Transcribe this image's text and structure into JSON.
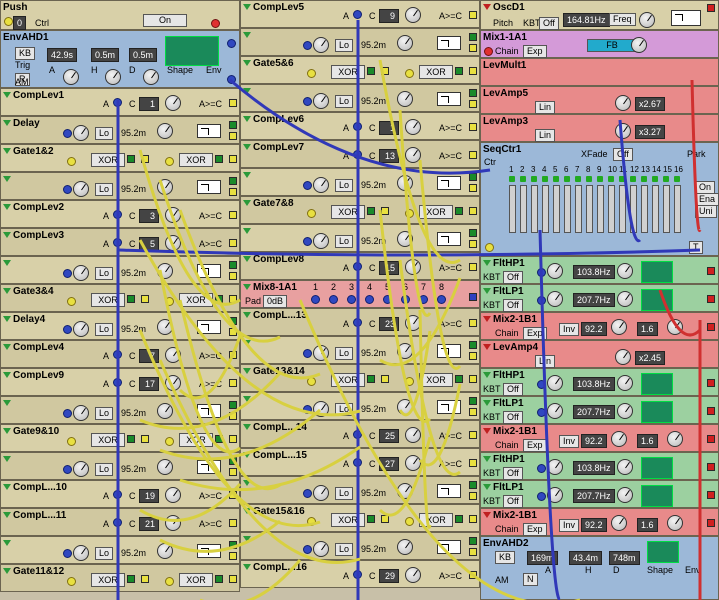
{
  "col1": [
    {
      "title": "Push",
      "ctrl_value": "0",
      "ctrl_label": "Ctrl",
      "on_label": "On",
      "color": "tan"
    },
    {
      "title": "EnvAHD1",
      "kb_label": "KB",
      "trig_label": "Trig",
      "r_label": "R",
      "am_label": "AM",
      "a_value": "42.9s",
      "h_value": "0.5m",
      "d_value": "0.5m",
      "a_label": "A",
      "h_label": "H",
      "d_label": "D",
      "shape_label": "Shape",
      "env_label": "Env",
      "color": "blue"
    },
    {
      "title": "CompLev1",
      "a_label": "A",
      "c_label": "C",
      "c_value": "1",
      "cmp_label": "A>=C",
      "color": "tan"
    },
    {
      "title": "Delay",
      "lo_label": "Lo",
      "value": "95.2m",
      "color": "tan"
    },
    {
      "title": "Gate1&2",
      "xor_label": "XOR",
      "color": "tan"
    },
    {
      "title": "",
      "lo_label": "Lo",
      "value": "95.2m",
      "color": "tan"
    },
    {
      "title": "CompLev2",
      "a_label": "A",
      "c_label": "C",
      "c_value": "3",
      "cmp_label": "A>=C",
      "color": "tan"
    },
    {
      "title": "CompLev3",
      "a_label": "A",
      "c_label": "C",
      "c_value": "5",
      "cmp_label": "A>=C",
      "color": "tan"
    },
    {
      "title": "",
      "lo_label": "Lo",
      "value": "95.2m",
      "color": "tan"
    },
    {
      "title": "Gate3&4",
      "xor_label": "XOR",
      "color": "tan"
    },
    {
      "title": "Delay4",
      "lo_label": "Lo",
      "value": "95.2m",
      "color": "tan"
    },
    {
      "title": "CompLev4",
      "a_label": "A",
      "c_label": "C",
      "c_value": "7",
      "cmp_label": "A>=C",
      "color": "tan"
    },
    {
      "title": "CompLev9",
      "a_label": "A",
      "c_label": "C",
      "c_value": "17",
      "cmp_label": "A>=C",
      "color": "tan"
    },
    {
      "title": "",
      "lo_label": "Lo",
      "value": "95.2m",
      "color": "tan"
    },
    {
      "title": "Gate9&10",
      "xor_label": "XOR",
      "color": "tan"
    },
    {
      "title": "",
      "lo_label": "Lo",
      "value": "95.2m",
      "color": "tan"
    },
    {
      "title": "CompL...10",
      "a_label": "A",
      "c_label": "C",
      "c_value": "19",
      "cmp_label": "A>=C",
      "color": "tan"
    },
    {
      "title": "CompL...11",
      "a_label": "A",
      "c_label": "C",
      "c_value": "21",
      "cmp_label": "A>=C",
      "color": "tan"
    },
    {
      "title": "",
      "lo_label": "Lo",
      "value": "95.2m",
      "color": "tan"
    },
    {
      "title": "Gate11&12",
      "xor_label": "XOR",
      "color": "tan"
    }
  ],
  "col2": [
    {
      "title": "CompLev5",
      "a_label": "A",
      "c_label": "C",
      "c_value": "9",
      "cmp_label": "A>=C"
    },
    {
      "title": "",
      "lo_label": "Lo",
      "value": "95.2m"
    },
    {
      "title": "Gate5&6",
      "xor_label": "XOR"
    },
    {
      "title": "",
      "lo_label": "Lo",
      "value": "95.2m"
    },
    {
      "title": "CompLev6",
      "a_label": "A",
      "c_label": "C",
      "c_value": "1",
      "cmp_label": "A>=C"
    },
    {
      "title": "CompLev7",
      "a_label": "A",
      "c_label": "C",
      "c_value": "13",
      "cmp_label": "A>=C"
    },
    {
      "title": "",
      "lo_label": "Lo",
      "value": "95.2m"
    },
    {
      "title": "Gate7&8",
      "xor_label": "XOR"
    },
    {
      "title": "",
      "lo_label": "Lo",
      "value": "95.2m"
    },
    {
      "title": "CompLev8",
      "a_label": "A",
      "c_label": "C",
      "c_value": "15",
      "cmp_label": "A>=C"
    },
    {
      "title": "Mix8-1A1",
      "pad_label": "Pad",
      "pad_value": "0dB",
      "inputs": [
        "1",
        "2",
        "3",
        "4",
        "5",
        "6",
        "7",
        "8"
      ]
    },
    {
      "title": "CompL...13",
      "a_label": "A",
      "c_label": "C",
      "c_value": "23",
      "cmp_label": "A>=C"
    },
    {
      "title": "",
      "lo_label": "Lo",
      "value": "95.2m"
    },
    {
      "title": "Gate13&14",
      "xor_label": "XOR"
    },
    {
      "title": "",
      "lo_label": "Lo",
      "value": "95.2m"
    },
    {
      "title": "CompL...14",
      "a_label": "A",
      "c_label": "C",
      "c_value": "25",
      "cmp_label": "A>=C"
    },
    {
      "title": "CompL...15",
      "a_label": "A",
      "c_label": "C",
      "c_value": "27",
      "cmp_label": "A>=C"
    },
    {
      "title": "",
      "lo_label": "Lo",
      "value": "95.2m"
    },
    {
      "title": "Gate15&16",
      "xor_label": "XOR"
    },
    {
      "title": "",
      "lo_label": "Lo",
      "value": "95.2m"
    },
    {
      "title": "CompL...16",
      "a_label": "A",
      "c_label": "C",
      "c_value": "29",
      "cmp_label": "A>=C"
    }
  ],
  "col3": {
    "osc": {
      "title": "OscD1",
      "pitch_label": "Pitch",
      "kbt_label": "KBT",
      "kbt_value": "Off",
      "freq_value": "164.81Hz",
      "freq_label": "Freq"
    },
    "mix1": {
      "title": "Mix1-1A1",
      "chain_label": "Chain",
      "exp_label": "Exp",
      "fb_label": "FB"
    },
    "levmult": {
      "title": "LevMult1"
    },
    "levamp5": {
      "title": "LevAmp5",
      "lin_label": "Lin",
      "value": "x2.67"
    },
    "levamp3": {
      "title": "LevAmp3",
      "lin_label": "Lin",
      "value": "x3.27"
    },
    "seq": {
      "title": "SeqCtr1",
      "xfade_label": "XFade",
      "xfade_value": "Off",
      "ctr_label": "Ctr",
      "park_label": "Park",
      "steps": [
        "1",
        "2",
        "3",
        "4",
        "5",
        "6",
        "7",
        "8",
        "9",
        "10",
        "11",
        "12",
        "13",
        "14",
        "15",
        "16"
      ],
      "side_labels": [
        "On",
        "Ena",
        "Uni"
      ],
      "t_label": "T"
    },
    "filters": [
      {
        "title": "FltHP1",
        "kbt_label": "KBT",
        "kbt_value": "Off",
        "value": "103.8Hz",
        "kind": "hp"
      },
      {
        "title": "FltLP1",
        "kbt_label": "KBT",
        "kbt_value": "Off",
        "value": "207.7Hz",
        "kind": "lp"
      }
    ],
    "mix2a": {
      "title": "Mix2-1B1",
      "chain_label": "Chain",
      "exp_label": "Exp",
      "inv_label": "Inv",
      "value": "92.2",
      "value2": "1.6"
    },
    "levamp4": {
      "title": "LevAmp4",
      "lin_label": "Lin",
      "value": "x2.45"
    },
    "filters2": [
      {
        "title": "FltHP1",
        "kbt_label": "KBT",
        "kbt_value": "Off",
        "value": "103.8Hz",
        "kind": "hp"
      },
      {
        "title": "FltLP1",
        "kbt_label": "KBT",
        "kbt_value": "Off",
        "value": "207.7Hz",
        "kind": "lp"
      }
    ],
    "mix2b": {
      "title": "Mix2-1B1",
      "chain_label": "Chain",
      "exp_label": "Exp",
      "inv_label": "Inv",
      "value": "92.2",
      "value2": "1.6"
    },
    "filters3": [
      {
        "title": "FltHP1",
        "kbt_label": "KBT",
        "kbt_value": "Off",
        "value": "103.8Hz",
        "kind": "hp"
      },
      {
        "title": "FltLP1",
        "kbt_label": "KBT",
        "kbt_value": "Off",
        "value": "207.7Hz",
        "kind": "lp"
      }
    ],
    "mix2c": {
      "title": "Mix2-1B1",
      "chain_label": "Chain",
      "exp_label": "Exp",
      "inv_label": "Inv",
      "value": "92.2",
      "value2": "1.6"
    },
    "env2": {
      "title": "EnvAHD2",
      "kb_label": "KB",
      "a_value": "169m",
      "h_value": "43.4m",
      "d_value": "748m",
      "a_label": "A",
      "h_label": "H",
      "d_label": "D",
      "shape_label": "Shape",
      "env_label": "Env",
      "am_label": "AM",
      "n_label": "N"
    }
  },
  "colors": {
    "tan": "#d8d0a8",
    "blue_module": "#9cb8d8",
    "pink_module": "#e88a8a",
    "purple_module": "#d49ad8",
    "green_module": "#9cd0a0",
    "cable_yellow": "#d8d040",
    "cable_blue": "#3038b8",
    "cable_red": "#d03030"
  }
}
